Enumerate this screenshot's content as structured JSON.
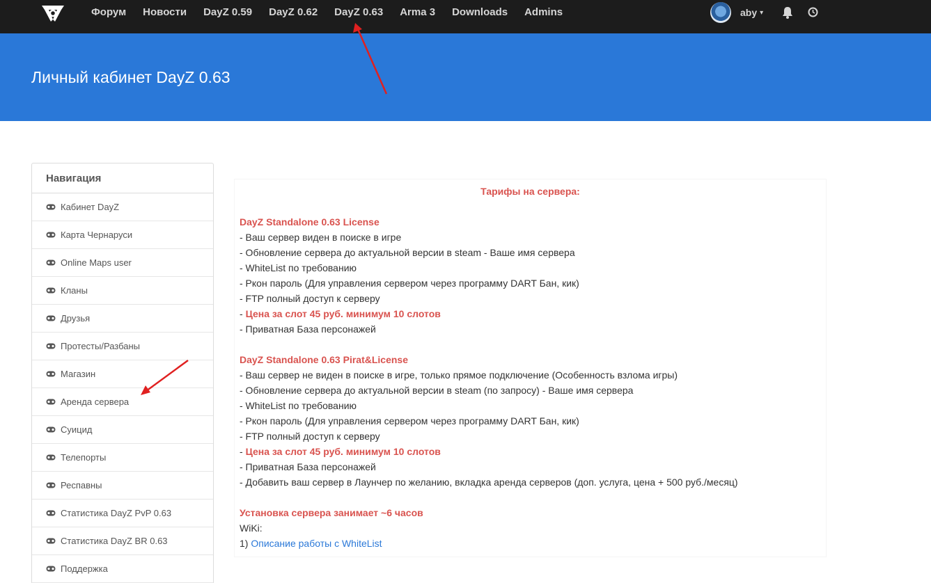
{
  "nav": {
    "items": [
      "Форум",
      "Новости",
      "DayZ 0.59",
      "DayZ 0.62",
      "DayZ 0.63",
      "Arma 3",
      "Downloads",
      "Admins"
    ],
    "user": "aby"
  },
  "banner": {
    "title": "Личный кабинет DayZ 0.63"
  },
  "sidebar": {
    "heading": "Навигация",
    "items": [
      "Кабинет DayZ",
      "Карта Чернаруси",
      "Online Maps user",
      "Кланы",
      "Друзья",
      "Протесты/Разбаны",
      "Магазин",
      "Аренда сервера",
      "Суицид",
      "Телепорты",
      "Респавны",
      "Статистика DayZ PvP 0.63",
      "Статистика DayZ BR 0.63",
      "Поддержка"
    ]
  },
  "content": {
    "title": "Тарифы на сервера:",
    "license": {
      "heading": "DayZ Standalone 0.63 License",
      "lines": [
        "- Ваш сервер виден в поиске в игре",
        "- Обновление сервера до актуальной версии в steam - Ваше имя сервера",
        "- WhiteList по требованию",
        "- Ркон пароль (Для управления сервером через программу DART Бан, кик)",
        "- FTP полный доступ к серверу"
      ],
      "price_prefix": "- ",
      "price": "Цена за слот 45 руб. минимум 10 слотов",
      "last": "- Приватная База персонажей"
    },
    "pirat": {
      "heading": "DayZ Standalone 0.63 Pirat&License",
      "lines": [
        "- Ваш сервер не виден в поиске в игре, только прямое подключение (Особенность взлома игры)",
        "- Обновление сервера до актуальной версии в steam (по запросу) - Ваше имя сервера",
        "- WhiteList по требованию",
        "- Ркон пароль (Для управления сервером через программу DART Бан, кик)",
        "- FTP полный доступ к серверу"
      ],
      "price_prefix": "- ",
      "price": "Цена за слот 45 руб. минимум 10 слотов",
      "tail": [
        "- Приватная База персонажей",
        "- Добавить ваш сервер в Лаунчер по желанию, вкладка аренда серверов (доп. услуга, цена + 500 руб./месяц)"
      ]
    },
    "install": "Установка сервера занимает ~6 часов",
    "wiki_label": "WiKi:",
    "wiki_prefix": "1) ",
    "wiki_link": "Описание работы с WhiteList"
  },
  "colors": {
    "banner": "#2a78d8",
    "topbar": "#1c1c1c",
    "accent_red": "#d9534f",
    "link": "#2a78d8",
    "arrow": "#e02020"
  },
  "icons": {
    "logo": "site-logo",
    "gamepad": "gamepad-icon",
    "bell": "bell-icon",
    "clock": "clock-icon",
    "caret": "chevron-down-icon"
  }
}
